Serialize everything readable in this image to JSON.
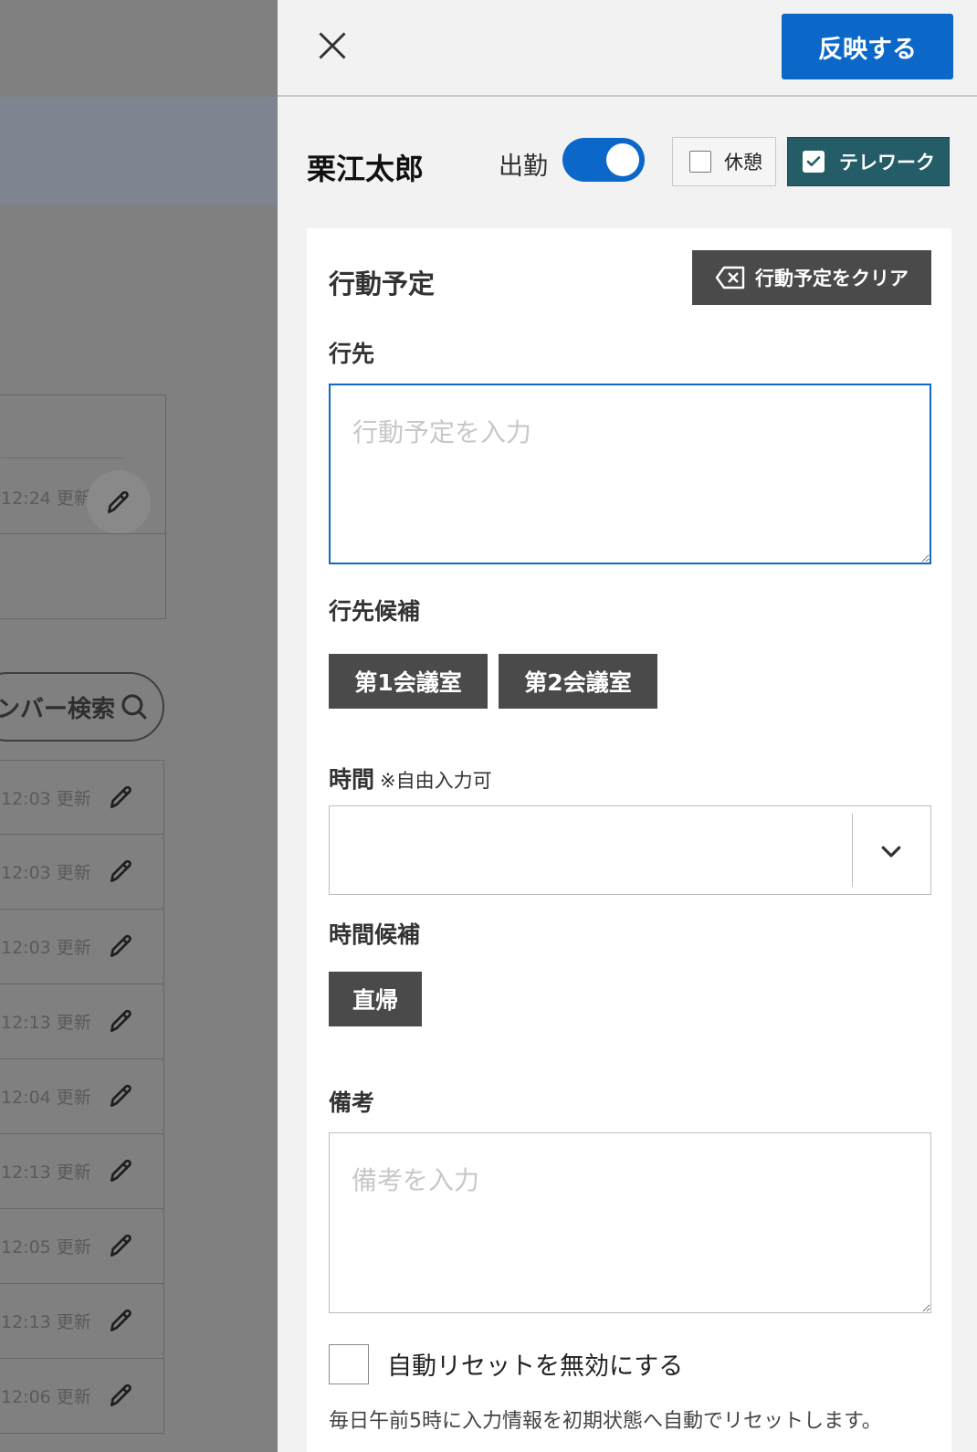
{
  "background": {
    "card_time": "12:24 更新",
    "search_label": "ンバー検索",
    "rows": [
      {
        "time": "12:03 更新"
      },
      {
        "time": "12:03 更新"
      },
      {
        "time": "12:03 更新"
      },
      {
        "time": "12:13 更新"
      },
      {
        "time": "12:04 更新"
      },
      {
        "time": "12:13 更新"
      },
      {
        "time": "12:05 更新"
      },
      {
        "time": "12:13 更新"
      },
      {
        "time": "12:06 更新"
      }
    ]
  },
  "panel": {
    "apply_label": "反映する",
    "person_name": "栗江太郎",
    "attendance_label": "出勤",
    "attendance_on": true,
    "break_label": "休憩",
    "break_checked": false,
    "telework_label": "テレワーク",
    "telework_checked": true,
    "accent_color": "#0b68c9",
    "telework_color": "#245d68"
  },
  "schedule": {
    "title": "行動予定",
    "clear_label": "行動予定をクリア",
    "destination_label": "行先",
    "destination_placeholder": "行動予定を入力",
    "destination_value": "",
    "destination_suggestions_label": "行先候補",
    "destination_suggestions": [
      "第1会議室",
      "第2会議室"
    ],
    "time_label": "時間",
    "time_note": "※自由入力可",
    "time_value": "",
    "time_suggestions_label": "時間候補",
    "time_suggestions": [
      "直帰"
    ],
    "notes_label": "備考",
    "notes_placeholder": "備考を入力",
    "notes_value": "",
    "auto_reset_label": "自動リセットを無効にする",
    "auto_reset_checked": false,
    "auto_reset_description": "毎日午前5時に入力情報を初期状態へ自動でリセットします。"
  }
}
